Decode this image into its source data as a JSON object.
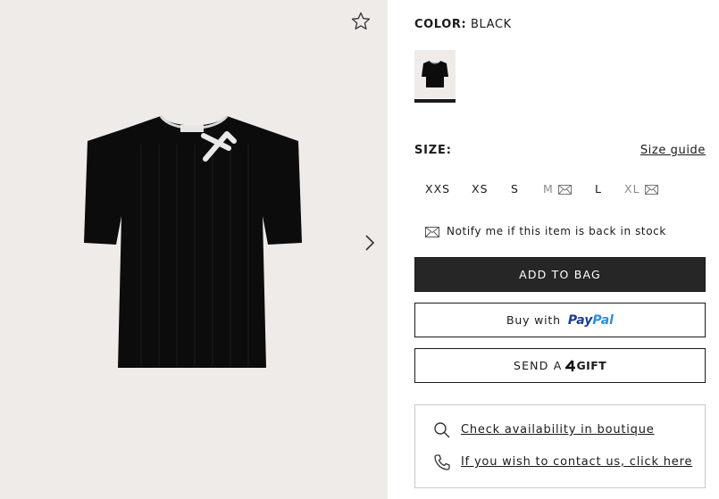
{
  "color": {
    "label": "COLOR:",
    "value": "BLACK",
    "swatch_name": "black-tshirt-swatch"
  },
  "size": {
    "label": "SIZE:",
    "guide_label": "Size guide",
    "options": [
      {
        "label": "XXS",
        "available": true
      },
      {
        "label": "XS",
        "available": true
      },
      {
        "label": "S",
        "available": true
      },
      {
        "label": "M",
        "available": false
      },
      {
        "label": "L",
        "available": true
      },
      {
        "label": "XL",
        "available": false
      }
    ]
  },
  "notify": {
    "text": "Notify me if this item is back in stock",
    "icon": "envelope-icon"
  },
  "buttons": {
    "add_to_bag": "ADD TO BAG",
    "buy_with": "Buy with",
    "paypal_pay": "Pay",
    "paypal_pal": "Pal",
    "send_a": "SEND A",
    "gift_suffix": "GIFT"
  },
  "boutique": {
    "check_label": "Check availability in boutique",
    "contact_label": "If you wish to contact us, click here"
  },
  "gallery": {
    "icons": [
      "star-icon",
      "chevron-right-icon"
    ]
  },
  "colors": {
    "accent": "#262626",
    "gallery_bg": "#efebe8",
    "paypal_dark": "#1b3f8f",
    "paypal_light": "#2a8fd9"
  }
}
